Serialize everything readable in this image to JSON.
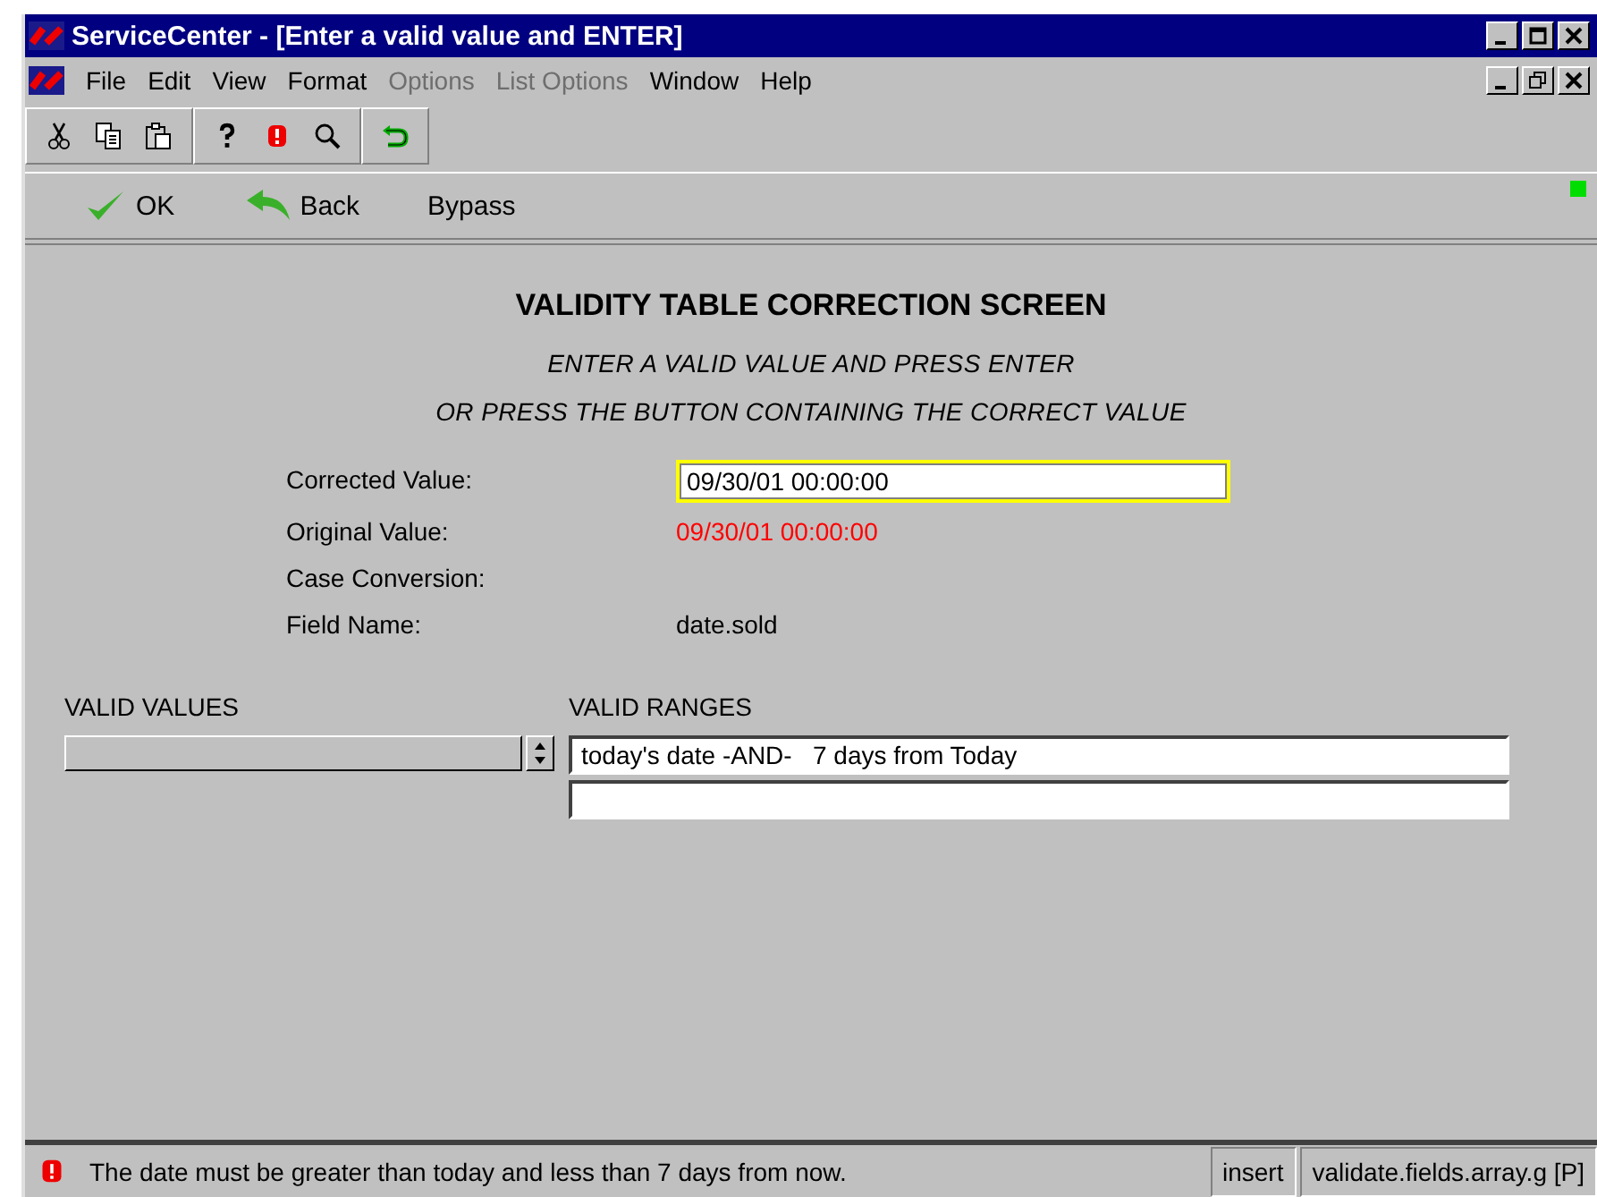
{
  "window": {
    "title": "ServiceCenter - [Enter a valid value and ENTER]"
  },
  "menu": [
    {
      "label": "File",
      "disabled": false
    },
    {
      "label": "Edit",
      "disabled": false
    },
    {
      "label": "View",
      "disabled": false
    },
    {
      "label": "Format",
      "disabled": false
    },
    {
      "label": "Options",
      "disabled": true
    },
    {
      "label": "List Options",
      "disabled": true
    },
    {
      "label": "Window",
      "disabled": false
    },
    {
      "label": "Help",
      "disabled": false
    }
  ],
  "actions": [
    {
      "label": "OK",
      "kind": "ok"
    },
    {
      "label": "Back",
      "kind": "back"
    },
    {
      "label": "Bypass",
      "kind": "plain"
    }
  ],
  "heading": "VALIDITY TABLE CORRECTION SCREEN",
  "instructions": [
    "ENTER A VALID VALUE AND PRESS ENTER",
    "OR PRESS THE BUTTON CONTAINING THE CORRECT VALUE"
  ],
  "fields": [
    {
      "label": "Corrected Value:",
      "value": "09/30/01 00:00:00",
      "kind": "input"
    },
    {
      "label": "Original Value:",
      "value": "09/30/01 00:00:00",
      "kind": "error"
    },
    {
      "label": "Case Conversion:",
      "kind": "text"
    },
    {
      "label": "Field Name:",
      "value": "date.sold",
      "kind": "text"
    }
  ],
  "valid_values": {
    "label": "VALID VALUES"
  },
  "valid_ranges": {
    "label": "VALID RANGES",
    "rows": [
      "today's date -AND-   7 days from Today"
    ]
  },
  "status_bar": {
    "message": "The date must be greater than today and less than 7 days from now.",
    "mode": "insert",
    "format": "validate.fields.array.g [P]"
  }
}
